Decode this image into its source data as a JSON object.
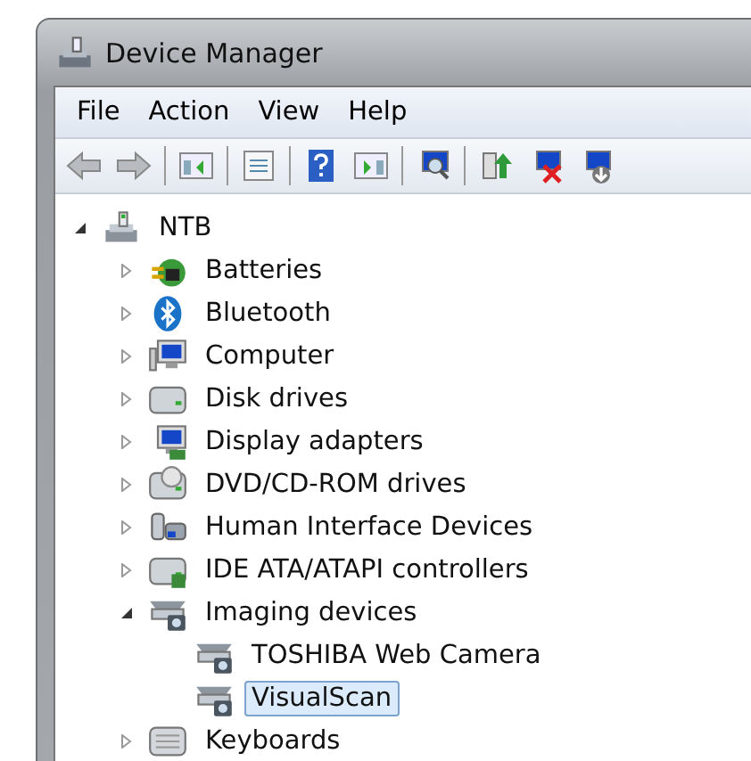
{
  "window": {
    "title": "Device Manager"
  },
  "menu": [
    "File",
    "Action",
    "View",
    "Help"
  ],
  "tree": [
    {
      "label": "NTB",
      "kind": "root",
      "expanded": true,
      "selected": false,
      "children": [
        {
          "label": "Batteries",
          "kind": "battery",
          "expanded": false,
          "selected": false
        },
        {
          "label": "Bluetooth",
          "kind": "bluetooth",
          "expanded": false,
          "selected": false
        },
        {
          "label": "Computer",
          "kind": "computer",
          "expanded": false,
          "selected": false
        },
        {
          "label": "Disk drives",
          "kind": "disk",
          "expanded": false,
          "selected": false
        },
        {
          "label": "Display adapters",
          "kind": "display",
          "expanded": false,
          "selected": false
        },
        {
          "label": "DVD/CD-ROM drives",
          "kind": "optical",
          "expanded": false,
          "selected": false
        },
        {
          "label": "Human Interface Devices",
          "kind": "hid",
          "expanded": false,
          "selected": false
        },
        {
          "label": "IDE ATA/ATAPI controllers",
          "kind": "ide",
          "expanded": false,
          "selected": false
        },
        {
          "label": "Imaging devices",
          "kind": "imaging",
          "expanded": true,
          "selected": false,
          "children": [
            {
              "label": "TOSHIBA Web Camera",
              "kind": "imaging",
              "selected": false
            },
            {
              "label": "VisualScan",
              "kind": "imaging",
              "selected": true
            }
          ]
        },
        {
          "label": "Keyboards",
          "kind": "keyboard",
          "expanded": false,
          "selected": false
        }
      ]
    }
  ]
}
